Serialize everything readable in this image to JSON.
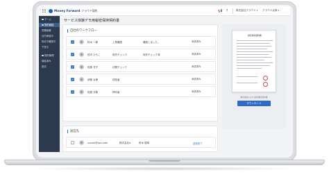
{
  "topbar": {
    "logo_text": "Money Forward",
    "logo_sub": "クラウド契約",
    "office_select": "株式会社クラウド",
    "user_select": "クラウド太郎"
  },
  "sidebar": {
    "items": [
      {
        "label": "ホーム"
      },
      {
        "label": "契約締結"
      },
      {
        "label": "書類依頼"
      },
      {
        "label": "社内承認中"
      },
      {
        "label": "相手方確認中"
      },
      {
        "label": "下書き"
      },
      {
        "label": "契約管理"
      },
      {
        "label": "締結済み"
      },
      {
        "label": "設定"
      }
    ]
  },
  "page_title": "サービス体験デモ用秘密保持契約書",
  "workflow": {
    "heading": "自社のワークフロー",
    "rows": [
      {
        "name": "鈴木 一郎",
        "role": "上長確認",
        "comment": "確認しました。",
        "status": "承認済み"
      },
      {
        "name": "田中 ひろこ",
        "role": "宛先チェック",
        "comment": "宛先チェック済",
        "status": "承認済み"
      },
      {
        "name": "佐藤 花子",
        "role": "法務チェック",
        "comment": "",
        "status": "承認済み"
      },
      {
        "name": "伊藤 太郎",
        "role": "送信者",
        "comment": "",
        "status": "承認済み"
      },
      {
        "name": "佐藤 次郎",
        "role": "押印者",
        "comment": "",
        "status": "承認済み"
      }
    ]
  },
  "recipient": {
    "heading": "送信先",
    "email": "suzuki@xxx.com",
    "company": "株式会社A",
    "person": "鈴木 優希",
    "status": "送信完了"
  },
  "preview": {
    "doc_title": "秘密保持契約書",
    "caption": "株式会社Aとの 秘密保持契約書",
    "download_label": "ダウンロード"
  }
}
